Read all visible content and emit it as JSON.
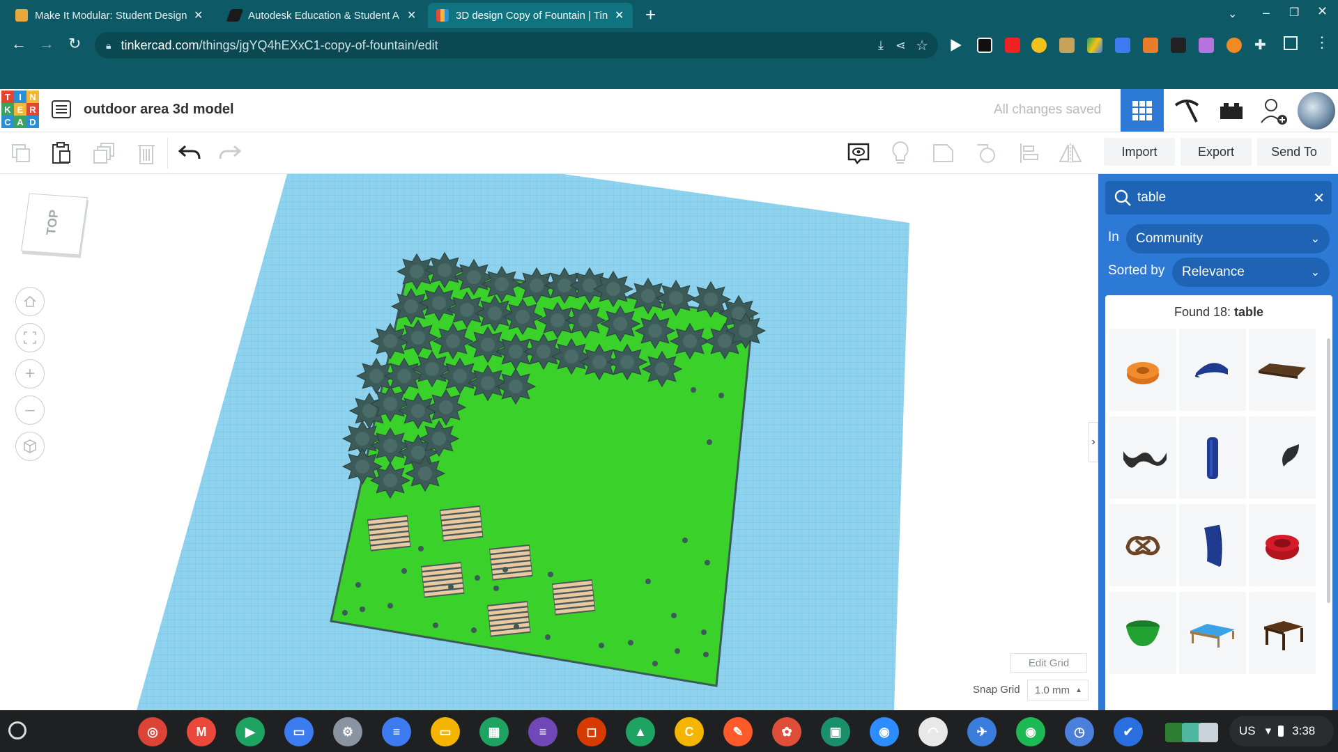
{
  "browser": {
    "tabs": [
      {
        "title": "Make It Modular: Student Design",
        "active": false
      },
      {
        "title": "Autodesk Education & Student A",
        "active": false
      },
      {
        "title": "3D design Copy of Fountain | Tin",
        "active": true
      }
    ],
    "new_tab_label": "+",
    "url_domain": "tinkercad.com",
    "url_path": "/things/jgYQ4hEXxC1-copy-of-fountain/edit"
  },
  "app": {
    "logo_letters": [
      "T",
      "I",
      "N",
      "K",
      "E",
      "R",
      "C",
      "A",
      "D"
    ],
    "design_title": "outdoor area 3d model",
    "save_status": "All changes saved"
  },
  "toolbar": {
    "import_label": "Import",
    "export_label": "Export",
    "send_to_label": "Send To"
  },
  "viewcube": {
    "face_label": "TOP"
  },
  "workplane": {
    "edit_grid_label": "Edit Grid",
    "snap_grid_label": "Snap Grid",
    "snap_grid_value": "1.0 mm"
  },
  "panel": {
    "search_value": "table",
    "in_label": "In",
    "in_value": "Community",
    "sorted_label": "Sorted by",
    "sorted_value": "Relevance",
    "found_prefix": "Found 18: ",
    "found_term": "table",
    "results": [
      {
        "name": "orange-ring-shape"
      },
      {
        "name": "blue-cap-shape"
      },
      {
        "name": "brown-plank-shape"
      },
      {
        "name": "dark-wave-shape"
      },
      {
        "name": "blue-cylinder-shape"
      },
      {
        "name": "dark-leaf-shape"
      },
      {
        "name": "pretzel-shape"
      },
      {
        "name": "blue-panel-shape"
      },
      {
        "name": "red-gear-shape"
      },
      {
        "name": "green-bowl-shape"
      },
      {
        "name": "blue-top-table-shape"
      },
      {
        "name": "brown-table-shape"
      }
    ]
  },
  "taskbar": {
    "apps": [
      "Chrome",
      "Gmail",
      "Play Store",
      "Files",
      "Settings",
      "Docs",
      "Slides",
      "Sheets",
      "Forms",
      "Office",
      "Drive",
      "C",
      "Canvas",
      "Paint",
      "Classroom",
      "Zoom",
      "Arc",
      "Bird",
      "Spotify",
      "Clock",
      "Tasks"
    ],
    "locale": "US",
    "time": "3:38"
  },
  "colors": {
    "chrome_bg": "#0d5a66",
    "panel_blue": "#2c7ad6",
    "grid_blue": "#8fd2ee",
    "ground_green": "#3ad12a",
    "tree_green": "#3b5a58"
  }
}
